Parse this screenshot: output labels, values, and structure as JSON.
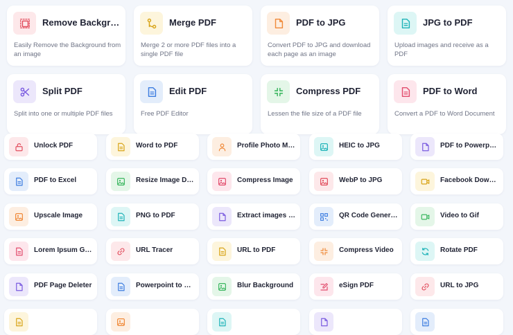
{
  "featured_tools": [
    {
      "title": "Remove Background",
      "description": "Easily Remove the Background from an image",
      "icon": "remove-background-icon",
      "icon_color": "#e24e5e",
      "tint": "#fde8ea"
    },
    {
      "title": "Merge PDF",
      "description": "Merge 2 or more PDF files into a single PDF file",
      "icon": "merge-icon",
      "icon_color": "#d8a418",
      "tint": "#fdf5dc"
    },
    {
      "title": "PDF to JPG",
      "description": "Convert PDF to JPG and download each page as an image",
      "icon": "file-icon",
      "icon_color": "#f08a3a",
      "tint": "#fdeee1"
    },
    {
      "title": "JPG to PDF",
      "description": "Upload images and receive as a PDF",
      "icon": "document-icon",
      "icon_color": "#1fb3b8",
      "tint": "#ddf6f5"
    },
    {
      "title": "Split PDF",
      "description": "Split into one or multiple PDF files",
      "icon": "scissors-icon",
      "icon_color": "#7a5be0",
      "tint": "#ece7fb"
    },
    {
      "title": "Edit PDF",
      "description": "Free PDF Editor",
      "icon": "document-icon",
      "icon_color": "#3d7de0",
      "tint": "#e3edfb"
    },
    {
      "title": "Compress PDF",
      "description": "Lessen the file size of a PDF file",
      "icon": "compress-icon",
      "icon_color": "#3cb761",
      "tint": "#e4f6e8"
    },
    {
      "title": "PDF to Word",
      "description": "Convert a PDF to Word Document",
      "icon": "document-icon",
      "icon_color": "#e24e6e",
      "tint": "#fde6ec"
    }
  ],
  "tools": [
    {
      "label": "Unlock PDF",
      "icon": "unlock-icon",
      "icon_color": "#e24e5e",
      "tint": "#fde8ea"
    },
    {
      "label": "Word to PDF",
      "icon": "document-icon",
      "icon_color": "#d8a418",
      "tint": "#fdf5dc"
    },
    {
      "label": "Profile Photo Maker",
      "icon": "user-icon",
      "icon_color": "#f08a3a",
      "tint": "#fdeee1"
    },
    {
      "label": "HEIC to JPG",
      "icon": "image-icon",
      "icon_color": "#1fb3b8",
      "tint": "#ddf6f5"
    },
    {
      "label": "PDF to Powerpoint",
      "icon": "file-icon",
      "icon_color": "#7a5be0",
      "tint": "#ece7fb"
    },
    {
      "label": "PDF to Excel",
      "icon": "document-icon",
      "icon_color": "#3d7de0",
      "tint": "#e3edfb"
    },
    {
      "label": "Resize Image Dimensions",
      "icon": "image-icon",
      "icon_color": "#3cb761",
      "tint": "#e4f6e8"
    },
    {
      "label": "Compress Image",
      "icon": "image-icon",
      "icon_color": "#e24e6e",
      "tint": "#fde6ec"
    },
    {
      "label": "WebP to JPG",
      "icon": "image-icon",
      "icon_color": "#e24e5e",
      "tint": "#fde8ea"
    },
    {
      "label": "Facebook Downloader",
      "icon": "video-icon",
      "icon_color": "#d8a418",
      "tint": "#fdf5dc"
    },
    {
      "label": "Upscale Image",
      "icon": "image-icon",
      "icon_color": "#f08a3a",
      "tint": "#fdeee1"
    },
    {
      "label": "PNG to PDF",
      "icon": "document-icon",
      "icon_color": "#1fb3b8",
      "tint": "#ddf6f5"
    },
    {
      "label": "Extract images PDF",
      "icon": "file-icon",
      "icon_color": "#7a5be0",
      "tint": "#ece7fb"
    },
    {
      "label": "QR Code Generator",
      "icon": "qr-code-icon",
      "icon_color": "#3d7de0",
      "tint": "#e3edfb"
    },
    {
      "label": "Video to Gif",
      "icon": "video-icon",
      "icon_color": "#3cb761",
      "tint": "#e4f6e8"
    },
    {
      "label": "Lorem Ipsum Generator",
      "icon": "document-icon",
      "icon_color": "#e24e6e",
      "tint": "#fde6ec"
    },
    {
      "label": "URL Tracer",
      "icon": "link-icon",
      "icon_color": "#e24e5e",
      "tint": "#fde8ea"
    },
    {
      "label": "URL to PDF",
      "icon": "document-icon",
      "icon_color": "#d8a418",
      "tint": "#fdf5dc"
    },
    {
      "label": "Compress Video",
      "icon": "compress-icon",
      "icon_color": "#f08a3a",
      "tint": "#fdeee1"
    },
    {
      "label": "Rotate PDF",
      "icon": "rotate-icon",
      "icon_color": "#1fb3b8",
      "tint": "#ddf6f5"
    },
    {
      "label": "PDF Page Deleter",
      "icon": "file-icon",
      "icon_color": "#7a5be0",
      "tint": "#ece7fb"
    },
    {
      "label": "Powerpoint to PDF",
      "icon": "document-icon",
      "icon_color": "#3d7de0",
      "tint": "#e3edfb"
    },
    {
      "label": "Blur Background",
      "icon": "image-icon",
      "icon_color": "#3cb761",
      "tint": "#e4f6e8"
    },
    {
      "label": "eSign PDF",
      "icon": "edit-icon",
      "icon_color": "#e24e6e",
      "tint": "#fde6ec"
    },
    {
      "label": "URL to JPG",
      "icon": "link-icon",
      "icon_color": "#e24e5e",
      "tint": "#fde8ea"
    },
    {
      "label": "",
      "icon": "document-icon",
      "icon_color": "#d8a418",
      "tint": "#fdf5dc"
    },
    {
      "label": "",
      "icon": "image-icon",
      "icon_color": "#f08a3a",
      "tint": "#fdeee1"
    },
    {
      "label": "",
      "icon": "document-icon",
      "icon_color": "#1fb3b8",
      "tint": "#ddf6f5"
    },
    {
      "label": "",
      "icon": "file-icon",
      "icon_color": "#7a5be0",
      "tint": "#ece7fb"
    },
    {
      "label": "",
      "icon": "document-icon",
      "icon_color": "#3d7de0",
      "tint": "#e3edfb"
    }
  ]
}
